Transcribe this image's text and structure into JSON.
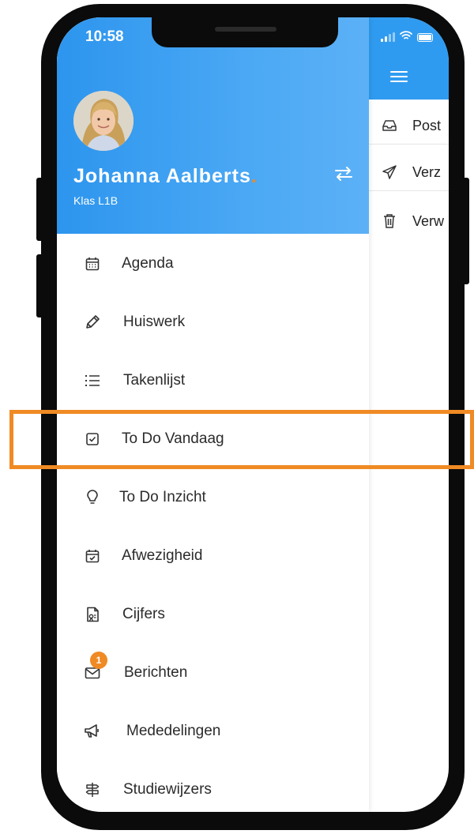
{
  "status_bar": {
    "time": "10:58"
  },
  "user": {
    "name": "Johanna  Aalberts",
    "name_dot": ".",
    "class": "Klas L1B"
  },
  "background_menu": [
    {
      "label": "Post",
      "icon": "inbox-icon"
    },
    {
      "label": "Verz",
      "icon": "send-icon"
    },
    {
      "label": "Verw",
      "icon": "trash-icon"
    }
  ],
  "menu": [
    {
      "label": "Agenda",
      "icon": "calendar-icon"
    },
    {
      "label": "Huiswerk",
      "icon": "pencil-icon"
    },
    {
      "label": "Takenlijst",
      "icon": "list-icon"
    },
    {
      "label": "To Do Vandaag",
      "icon": "checkbox-icon"
    },
    {
      "label": "To Do Inzicht",
      "icon": "lightbulb-icon"
    },
    {
      "label": "Afwezigheid",
      "icon": "calendar-check-icon"
    },
    {
      "label": "Cijfers",
      "icon": "grade-document-icon"
    },
    {
      "label": "Berichten",
      "icon": "envelope-icon",
      "badge": "1"
    },
    {
      "label": "Mededelingen",
      "icon": "megaphone-icon"
    },
    {
      "label": "Studiewijzers",
      "icon": "signpost-icon"
    }
  ],
  "colors": {
    "header_blue": "#2f9bf0",
    "accent_orange": "#f08a24"
  }
}
